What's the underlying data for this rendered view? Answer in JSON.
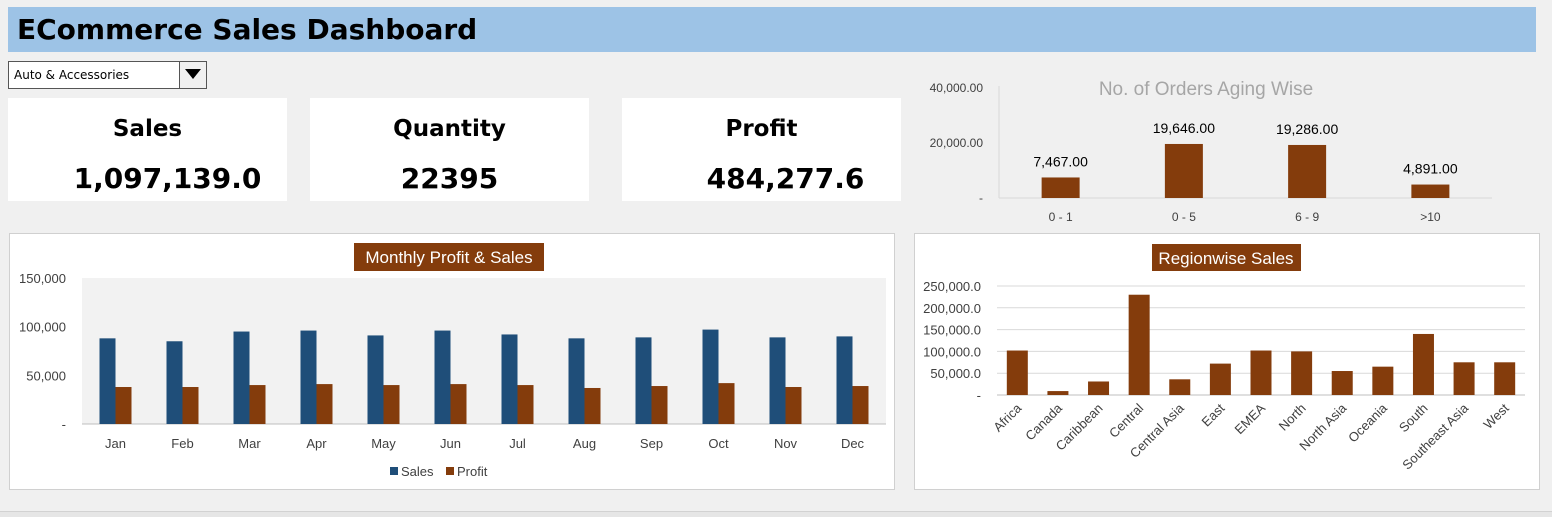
{
  "header": {
    "title": "ECommerce Sales Dashboard"
  },
  "filter": {
    "selected": "Auto & Accessories"
  },
  "kpis": {
    "sales": {
      "label": "Sales",
      "value": "1,097,139.0"
    },
    "quantity": {
      "label": "Quantity",
      "value": "22395"
    },
    "profit": {
      "label": "Profit",
      "value": "484,277.6"
    }
  },
  "colors": {
    "header": "#9dc3e6",
    "sales": "#1f4e79",
    "profit": "#843c0c",
    "title_box": "#843c0c"
  },
  "chart_data": [
    {
      "type": "bar",
      "title": "No. of Orders Aging Wise",
      "categories": [
        "0 - 1",
        "0 - 5",
        "6 - 9",
        ">10"
      ],
      "values": [
        7467,
        19646,
        19286,
        4891
      ],
      "data_labels": [
        "7,467.00",
        "19,646.00",
        "19,286.00",
        "4,891.00"
      ],
      "y_ticks": [
        "-",
        "20,000.00",
        "40,000.00"
      ],
      "ylim": [
        0,
        40000
      ],
      "grid": false,
      "legend": "none"
    },
    {
      "type": "bar",
      "title": "Monthly Profit & Sales",
      "categories": [
        "Jan",
        "Feb",
        "Mar",
        "Apr",
        "May",
        "Jun",
        "Jul",
        "Aug",
        "Sep",
        "Oct",
        "Nov",
        "Dec"
      ],
      "series": [
        {
          "name": "Sales",
          "values": [
            88000,
            85000,
            95000,
            96000,
            91000,
            96000,
            92000,
            88000,
            89000,
            97000,
            89000,
            90000
          ]
        },
        {
          "name": "Profit",
          "values": [
            38000,
            38000,
            40000,
            41000,
            40000,
            41000,
            40000,
            37000,
            39000,
            42000,
            38000,
            39000
          ]
        }
      ],
      "y_ticks": [
        "-",
        "50,000",
        "100,000",
        "150,000"
      ],
      "ylim": [
        0,
        150000
      ],
      "grid": false,
      "legend": "bottom"
    },
    {
      "type": "bar",
      "title": "Regionwise Sales",
      "categories": [
        "Africa",
        "Canada",
        "Caribbean",
        "Central",
        "Central Asia",
        "East",
        "EMEA",
        "North",
        "North Asia",
        "Oceania",
        "South",
        "Southeast Asia",
        "West"
      ],
      "values": [
        102000,
        9000,
        31000,
        230000,
        36000,
        72000,
        102000,
        100000,
        55000,
        65000,
        140000,
        75000,
        75000
      ],
      "y_ticks": [
        "-",
        "50,000.0",
        "100,000.0",
        "150,000.0",
        "200,000.0",
        "250,000.0"
      ],
      "ylim": [
        0,
        250000
      ],
      "grid": true,
      "legend": "none"
    }
  ]
}
